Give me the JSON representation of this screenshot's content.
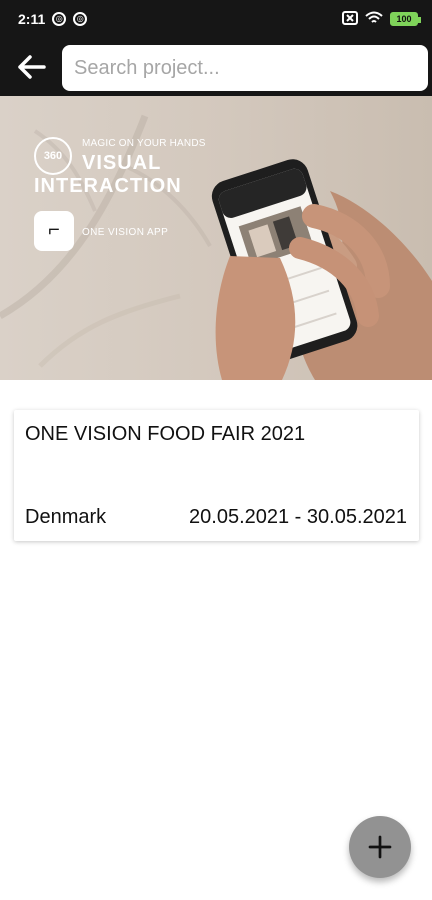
{
  "status_bar": {
    "time": "2:11",
    "icons": [
      "notification-circle-icon",
      "notification-circle-icon",
      "close-box-icon",
      "wifi-icon",
      "battery-icon"
    ],
    "battery": "100"
  },
  "header": {
    "back_icon": "back-arrow-icon",
    "search_placeholder": "Search project..."
  },
  "banner": {
    "badge": "360",
    "tagline": "MAGIC ON YOUR HANDS",
    "title_line1": "VISUAL",
    "title_line2": "INTERACTION",
    "app_name": "ONE VISION APP"
  },
  "project": {
    "title": "ONE VISION FOOD FAIR 2021",
    "country": "Denmark",
    "dates": "20.05.2021 - 30.05.2021"
  },
  "fab": {
    "icon": "plus-icon"
  },
  "colors": {
    "top_bar": "#161616",
    "fab": "#929292",
    "text": "#111111"
  }
}
